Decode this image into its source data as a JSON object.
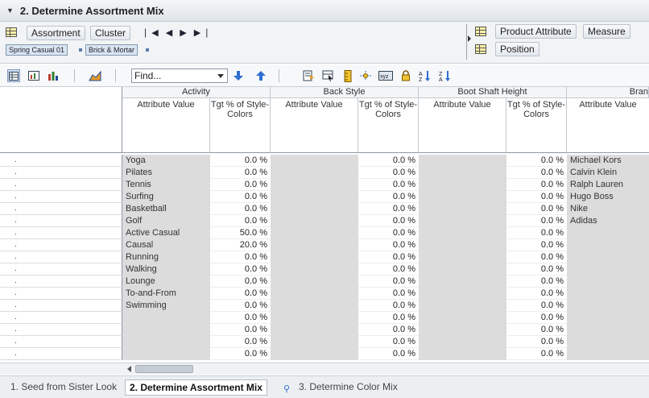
{
  "window": {
    "title": "2. Determine Assortment Mix"
  },
  "pivot": {
    "left_tiles": [
      "Assortment",
      "Cluster"
    ],
    "nav_arrows": "❘◀ ◀ ▶ ▶❘",
    "filters": [
      "Spring Casual 01",
      "Brick & Mortar"
    ],
    "right_tiles": [
      "Product Attribute",
      "Measure",
      "Position"
    ]
  },
  "toolbar": {
    "find_placeholder": "Find..."
  },
  "grid": {
    "groups": [
      "Activity",
      "Back Style",
      "Boot Shaft Height",
      "Bran"
    ],
    "sub_attr": "Attribute Value",
    "sub_val": "Tgt % of Style-Colors",
    "row_marker": ".",
    "activity_values": [
      "Yoga",
      "Pilates",
      "Tennis",
      "Surfing",
      "Basketball",
      "Golf",
      "Active Casual",
      "Causal",
      "Running",
      "Walking",
      "Lounge",
      "To-and-From",
      "Swimming",
      "",
      "",
      "",
      ""
    ],
    "activity_pct": [
      "0.0 %",
      "0.0 %",
      "0.0 %",
      "0.0 %",
      "0.0 %",
      "0.0 %",
      "50.0 %",
      "20.0 %",
      "0.0 %",
      "0.0 %",
      "0.0 %",
      "0.0 %",
      "0.0 %",
      "0.0 %",
      "0.0 %",
      "0.0 %",
      "0.0 %"
    ],
    "back_pct": [
      "0.0 %",
      "0.0 %",
      "0.0 %",
      "0.0 %",
      "0.0 %",
      "0.0 %",
      "0.0 %",
      "0.0 %",
      "0.0 %",
      "0.0 %",
      "0.0 %",
      "0.0 %",
      "0.0 %",
      "0.0 %",
      "0.0 %",
      "0.0 %",
      "0.0 %"
    ],
    "boot_pct": [
      "0.0 %",
      "0.0 %",
      "0.0 %",
      "0.0 %",
      "0.0 %",
      "0.0 %",
      "0.0 %",
      "0.0 %",
      "0.0 %",
      "0.0 %",
      "0.0 %",
      "0.0 %",
      "0.0 %",
      "0.0 %",
      "0.0 %",
      "0.0 %",
      "0.0 %"
    ],
    "brand_values": [
      "Michael Kors",
      "Calvin Klein",
      "Ralph Lauren",
      "Hugo Boss",
      "Nike",
      "Adidas"
    ]
  },
  "tabs": [
    {
      "label": "1. Seed from Sister Look",
      "active": false
    },
    {
      "label": "2. Determine Assortment Mix",
      "active": true
    },
    {
      "label": "3. Determine Color Mix",
      "active": false
    }
  ]
}
